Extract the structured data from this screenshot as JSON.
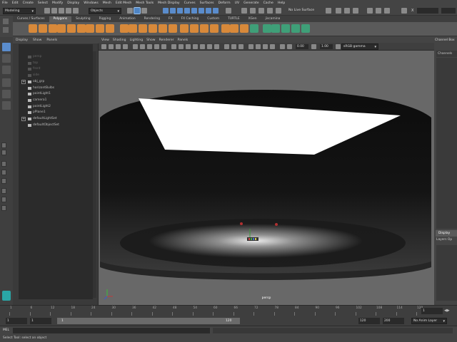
{
  "menubar": {
    "items": [
      "File",
      "Edit",
      "Create",
      "Select",
      "Modify",
      "Display",
      "Windows",
      "Mesh",
      "Edit Mesh",
      "Mesh Tools",
      "Mesh Display",
      "Curves",
      "Surfaces",
      "Deform",
      "UV",
      "Generate",
      "Cache",
      "Help"
    ]
  },
  "statusline": {
    "mode": "Modeling",
    "select_mode": "Objects",
    "live_surface": "No Live Surface",
    "x_label": "X"
  },
  "shelf": {
    "tabs": [
      "Curves / Surfaces",
      "Polygons",
      "Sculpting",
      "Rigging",
      "Animation",
      "Rendering",
      "FX",
      "FX Caching",
      "Custom",
      "TURTLE",
      "XGen",
      "jiscamina"
    ],
    "active_tab": "Polygons"
  },
  "outliner": {
    "menu": [
      "Display",
      "Show",
      "Panels"
    ],
    "items": [
      {
        "label": "persp",
        "state": "dim",
        "expand": ""
      },
      {
        "label": "top",
        "state": "dim",
        "expand": ""
      },
      {
        "label": "front",
        "state": "dim",
        "expand": ""
      },
      {
        "label": "side",
        "state": "dim",
        "expand": ""
      },
      {
        "label": "obj_grp",
        "state": "normal",
        "expand": "+"
      },
      {
        "label": "horizontBulbs",
        "state": "normal",
        "expand": ""
      },
      {
        "label": "pointLight1",
        "state": "normal",
        "expand": ""
      },
      {
        "label": "camera1",
        "state": "normal",
        "expand": ""
      },
      {
        "label": "pointLight2",
        "state": "normal",
        "expand": ""
      },
      {
        "label": "pPlane1",
        "state": "normal",
        "expand": ""
      },
      {
        "label": "defaultLightSet",
        "state": "normal",
        "expand": "+"
      },
      {
        "label": "defaultObjectSet",
        "state": "normal",
        "expand": ""
      }
    ]
  },
  "viewport": {
    "menu": [
      "View",
      "Shading",
      "Lighting",
      "Show",
      "Renderer",
      "Panels"
    ],
    "field1": "0.00",
    "field2": "1.00",
    "color_space": "sRGB gamma",
    "camera_label": "persp"
  },
  "channelbox": {
    "title": "Channel Box",
    "tab": "Channels",
    "layer_header": "Display",
    "layer_menu": "Layers  Op"
  },
  "timeline": {
    "ticks": [
      "1",
      "6",
      "12",
      "18",
      "24",
      "30",
      "36",
      "42",
      "48",
      "54",
      "60",
      "66",
      "72",
      "78",
      "84",
      "90",
      "96",
      "102",
      "108",
      "114",
      "120"
    ],
    "current_frame": "1"
  },
  "range": {
    "start": "1",
    "playback_start": "1",
    "range_start_label": "1",
    "range_end_label": "120",
    "playback_end": "120",
    "end": "200",
    "anim_layer": "No Anim Layer"
  },
  "cmdline": {
    "label": "MEL"
  },
  "helpline": {
    "text": "Select Tool: select an object"
  }
}
